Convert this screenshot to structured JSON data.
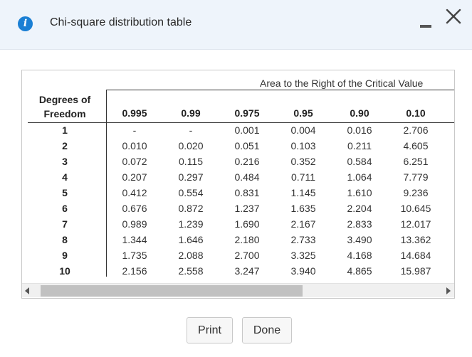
{
  "dialog": {
    "title": "Chi-square distribution table",
    "icon": "info-icon"
  },
  "table": {
    "area_header": "Area to the Right of the Critical Value",
    "dof_header_line1": "Degrees of",
    "dof_header_line2": "Freedom",
    "columns": [
      "0.995",
      "0.99",
      "0.975",
      "0.95",
      "0.90",
      "0.10"
    ],
    "rows": [
      {
        "df": "1",
        "values": [
          "-",
          "-",
          "0.001",
          "0.004",
          "0.016",
          "2.706"
        ]
      },
      {
        "df": "2",
        "values": [
          "0.010",
          "0.020",
          "0.051",
          "0.103",
          "0.211",
          "4.605"
        ]
      },
      {
        "df": "3",
        "values": [
          "0.072",
          "0.115",
          "0.216",
          "0.352",
          "0.584",
          "6.251"
        ]
      },
      {
        "df": "4",
        "values": [
          "0.207",
          "0.297",
          "0.484",
          "0.711",
          "1.064",
          "7.779"
        ]
      },
      {
        "df": "5",
        "values": [
          "0.412",
          "0.554",
          "0.831",
          "1.145",
          "1.610",
          "9.236"
        ]
      },
      {
        "df": "6",
        "values": [
          "0.676",
          "0.872",
          "1.237",
          "1.635",
          "2.204",
          "10.645"
        ]
      },
      {
        "df": "7",
        "values": [
          "0.989",
          "1.239",
          "1.690",
          "2.167",
          "2.833",
          "12.017"
        ]
      },
      {
        "df": "8",
        "values": [
          "1.344",
          "1.646",
          "2.180",
          "2.733",
          "3.490",
          "13.362"
        ]
      },
      {
        "df": "9",
        "values": [
          "1.735",
          "2.088",
          "2.700",
          "3.325",
          "4.168",
          "14.684"
        ]
      },
      {
        "df": "10",
        "values": [
          "2.156",
          "2.558",
          "3.247",
          "3.940",
          "4.865",
          "15.987"
        ]
      }
    ]
  },
  "buttons": {
    "print_label": "Print",
    "done_label": "Done"
  },
  "colors": {
    "title_bar": "#eef4fb",
    "info_icon": "#1a7fd4"
  }
}
